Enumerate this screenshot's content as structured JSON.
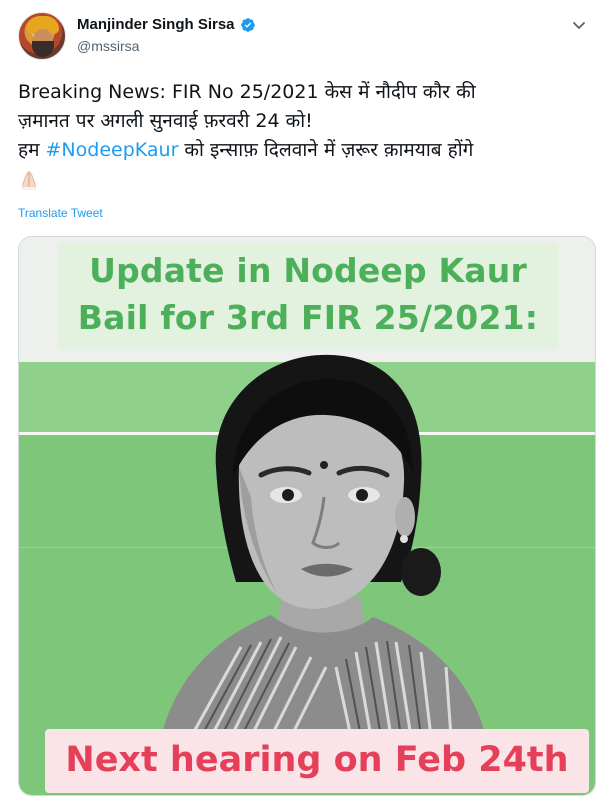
{
  "author": {
    "display_name": "Manjinder Singh Sirsa",
    "handle": "@mssirsa",
    "verified": true,
    "avatar_icon": "avatar-photo"
  },
  "tweet": {
    "line1": "Breaking News: FIR No 25/2021 केस में नौदीप कौर की",
    "line2": "ज़मानत पर अगली सुनवाई फ़रवरी 24 को!",
    "line3_prefix": "हम ",
    "hashtag": "#NodeepKaur",
    "line3_suffix": " को इन्साफ़ दिलवाने में ज़रूर क़ामयाब होंगे",
    "emoji": "folded-hands-emoji"
  },
  "translate_label": "Translate Tweet",
  "media": {
    "headline_line1": "Update in Nodeep Kaur",
    "headline_line2": "Bail for 3rd FIR 25/2021:",
    "footer_text": "Next hearing on Feb 24th",
    "colors": {
      "headline_green": "#4cb05a",
      "background_green": "#7dc67a",
      "footer_red": "#e5405a",
      "footer_bg": "#fbe4e8"
    }
  },
  "colors": {
    "link_blue": "#1d9bf0",
    "text": "#0f1419",
    "secondary": "#536471"
  }
}
